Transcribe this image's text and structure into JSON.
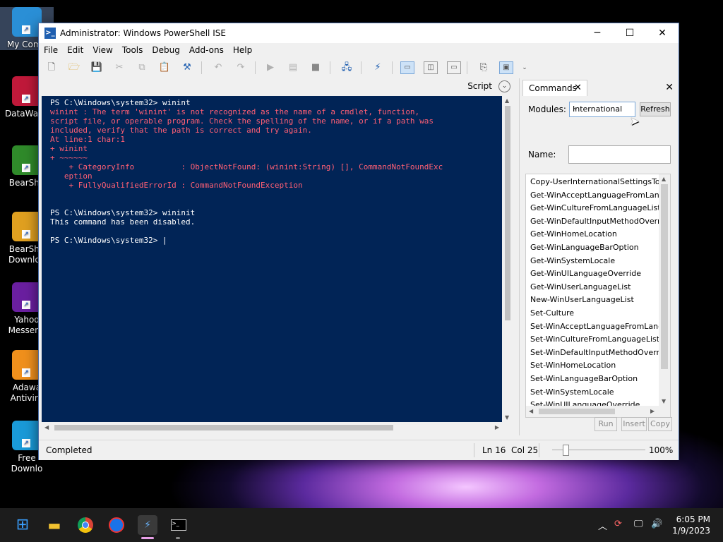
{
  "desktop": {
    "icons": [
      {
        "label": "My Comp",
        "color": "#2a8fd6"
      },
      {
        "label": "DataWage",
        "color": "#c0193a"
      },
      {
        "label": "BearSha",
        "color": "#2f8a2a"
      },
      {
        "label": "BearSha\nDownloa",
        "color": "#e0a020"
      },
      {
        "label": "Yahoo\nMesseng",
        "color": "#6a1fa0"
      },
      {
        "label": "Adawa\nAntiviru",
        "color": "#f0901c"
      },
      {
        "label": "Free\nDownlo",
        "color": "#1a9ad8"
      }
    ]
  },
  "window": {
    "title": "Administrator: Windows PowerShell ISE",
    "minimize": "─",
    "maximize": "☐",
    "close": "✕"
  },
  "menu": [
    "File",
    "Edit",
    "View",
    "Tools",
    "Debug",
    "Add-ons",
    "Help"
  ],
  "scriptbar": {
    "label": "Script"
  },
  "console": {
    "lines": [
      {
        "text": "PS C:\\Windows\\system32> winint",
        "color": "w"
      },
      {
        "text": "winint : The term 'winint' is not recognized as the name of a cmdlet, function,",
        "color": "r"
      },
      {
        "text": "script file, or operable program. Check the spelling of the name, or if a path was",
        "color": "r"
      },
      {
        "text": "included, verify that the path is correct and try again.",
        "color": "r"
      },
      {
        "text": "At line:1 char:1",
        "color": "r"
      },
      {
        "text": "+ winint",
        "color": "r"
      },
      {
        "text": "+ ~~~~~~",
        "color": "r"
      },
      {
        "text": "    + CategoryInfo          : ObjectNotFound: (winint:String) [], CommandNotFoundExc",
        "color": "r"
      },
      {
        "text": "   eption",
        "color": "r"
      },
      {
        "text": "    + FullyQualifiedErrorId : CommandNotFoundException",
        "color": "r"
      },
      {
        "text": "",
        "color": "w"
      },
      {
        "text": "",
        "color": "w"
      },
      {
        "text": "PS C:\\Windows\\system32> wininit",
        "color": "w"
      },
      {
        "text": "This command has been disabled.",
        "color": "w"
      },
      {
        "text": "",
        "color": "w"
      },
      {
        "text": "PS C:\\Windows\\system32> |",
        "color": "w"
      }
    ]
  },
  "commands": {
    "tab_label": "Commands",
    "modules_label": "Modules:",
    "modules_value": "International",
    "refresh_label": "Refresh",
    "name_label": "Name:",
    "name_value": "",
    "items": [
      "Copy-UserInternationalSettingsToSystem",
      "Get-WinAcceptLanguageFromLanguageListOptOut",
      "Get-WinCultureFromLanguageListOptOut",
      "Get-WinDefaultInputMethodOverride",
      "Get-WinHomeLocation",
      "Get-WinLanguageBarOption",
      "Get-WinSystemLocale",
      "Get-WinUILanguageOverride",
      "Get-WinUserLanguageList",
      "New-WinUserLanguageList",
      "Set-Culture",
      "Set-WinAcceptLanguageFromLanguageListOptOut",
      "Set-WinCultureFromLanguageListOptOut",
      "Set-WinDefaultInputMethodOverride",
      "Set-WinHomeLocation",
      "Set-WinLanguageBarOption",
      "Set-WinSystemLocale",
      "Set-WinUILanguageOverride"
    ],
    "run_label": "Run",
    "insert_label": "Insert",
    "copy_label": "Copy"
  },
  "status": {
    "state": "Completed",
    "position": "Ln 16  Col 25",
    "zoom": "100%",
    "zoom_level_percent": 100
  },
  "taskbar": {
    "time": "6:05 PM",
    "date": "1/9/2023",
    "accent": "#e8a0e8"
  }
}
